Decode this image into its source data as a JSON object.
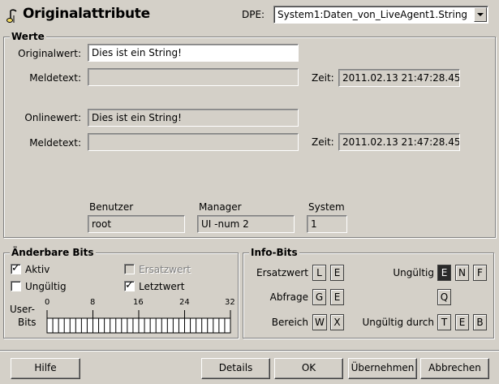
{
  "header": {
    "title": "Originalattribute",
    "dpe_label": "DPE:",
    "dpe_value": "System1:Daten_von_LiveAgent1.String"
  },
  "werte": {
    "group_title": "Werte",
    "originalwert_label": "Originalwert:",
    "originalwert_value": "Dies ist ein String!",
    "meldetext1_label": "Meldetext:",
    "meldetext1_value": "",
    "zeit1_label": "Zeit:",
    "zeit1_value": "2011.02.13 21:47:28.450",
    "onlinewert_label": "Onlinewert:",
    "onlinewert_value": "Dies ist ein String!",
    "meldetext2_label": "Meldetext:",
    "meldetext2_value": "",
    "zeit2_label": "Zeit:",
    "zeit2_value": "2011.02.13 21:47:28.450",
    "benutzer_label": "Benutzer",
    "benutzer_value": "root",
    "manager_label": "Manager",
    "manager_value": "UI -num 2",
    "system_label": "System",
    "system_value": "1"
  },
  "aenderbare_bits": {
    "group_title": "Änderbare Bits",
    "aktiv_label": "Aktiv",
    "aktiv_checked": true,
    "ungueltig_label": "Ungültig",
    "ungueltig_checked": false,
    "ersatzwert_label": "Ersatzwert",
    "ersatzwert_checked": false,
    "letztwert_label": "Letztwert",
    "letztwert_checked": true,
    "user_bits_label_1": "User-",
    "user_bits_label_2": "Bits",
    "scale": [
      "0",
      "8",
      "16",
      "24",
      "32"
    ]
  },
  "info_bits": {
    "group_title": "Info-Bits",
    "ersatzwert_label": "Ersatzwert",
    "ersatzwert_boxes": [
      "L",
      "E"
    ],
    "abfrage_label": "Abfrage",
    "abfrage_boxes": [
      "G",
      "E"
    ],
    "bereich_label": "Bereich",
    "bereich_boxes": [
      "W",
      "X"
    ],
    "ungueltig_label": "Ungültig",
    "ungueltig_boxes": [
      "E",
      "N",
      "F"
    ],
    "ungueltig_active": "E",
    "q_box": "Q",
    "ungueltig_durch_label": "Ungültig durch",
    "ungueltig_durch_boxes": [
      "T",
      "E",
      "B"
    ]
  },
  "buttons": {
    "hilfe": "Hilfe",
    "details": "Details",
    "ok": "OK",
    "uebernehmen": "Übernehmen",
    "abbrechen": "Abbrechen"
  },
  "colors": {
    "background": "#d4d0c8",
    "active_bit": "#2a2a2a"
  }
}
